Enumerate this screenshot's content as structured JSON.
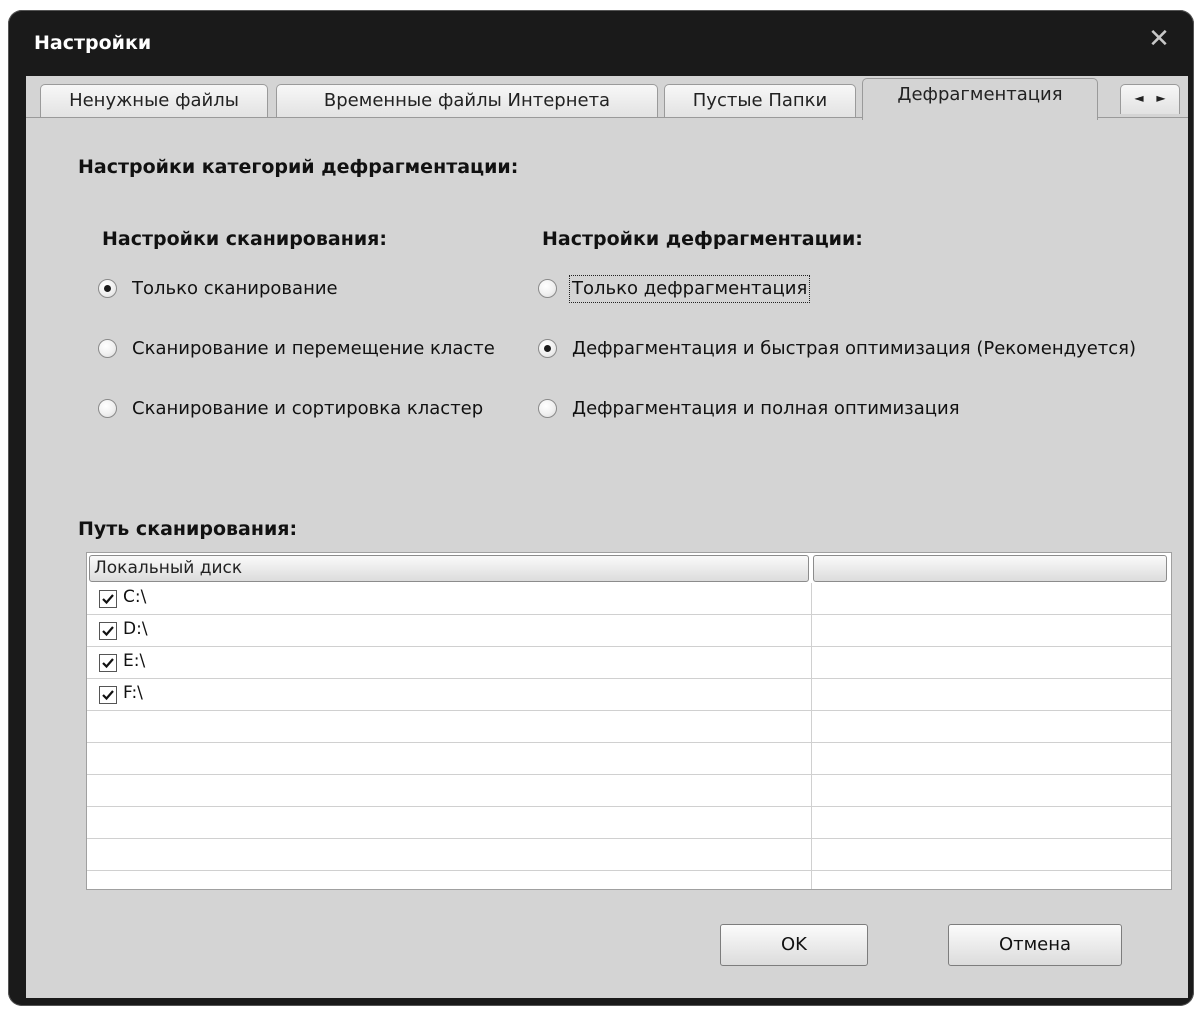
{
  "window": {
    "title": "Настройки"
  },
  "tabs": [
    {
      "label": "Ненужные файлы"
    },
    {
      "label": "Временные файлы Интернета"
    },
    {
      "label": "Пустые Папки"
    },
    {
      "label": "Дефрагментация",
      "active": true
    }
  ],
  "tab_scroll": {
    "left": "◄",
    "right": "►"
  },
  "section_title": "Настройки категорий дефрагментации:",
  "scan_settings": {
    "title": "Настройки сканирования:",
    "options": [
      {
        "label": "Только сканирование",
        "checked": true
      },
      {
        "label": "Сканирование и перемещение класте",
        "checked": false
      },
      {
        "label": "Сканирование и сортировка кластер",
        "checked": false
      }
    ]
  },
  "defrag_settings": {
    "title": "Настройки дефрагментации:",
    "options": [
      {
        "label": "Только дефрагментация",
        "checked": false,
        "focused": true
      },
      {
        "label": "Дефрагментация и быстрая оптимизация (Рекомендуется)",
        "checked": true
      },
      {
        "label": "Дефрагментация и полная оптимизация",
        "checked": false
      }
    ]
  },
  "scan_path": {
    "title": "Путь сканирования:",
    "columns": [
      "Локальный диск",
      ""
    ],
    "rows": [
      {
        "drive": "C:\\",
        "checked": true
      },
      {
        "drive": "D:\\",
        "checked": true
      },
      {
        "drive": "E:\\",
        "checked": true
      },
      {
        "drive": "F:\\",
        "checked": true
      }
    ]
  },
  "buttons": {
    "ok": "OK",
    "cancel": "Отмена"
  },
  "colors": {
    "titlebar": "#1a1a1a",
    "client": "#d4d4d4"
  }
}
